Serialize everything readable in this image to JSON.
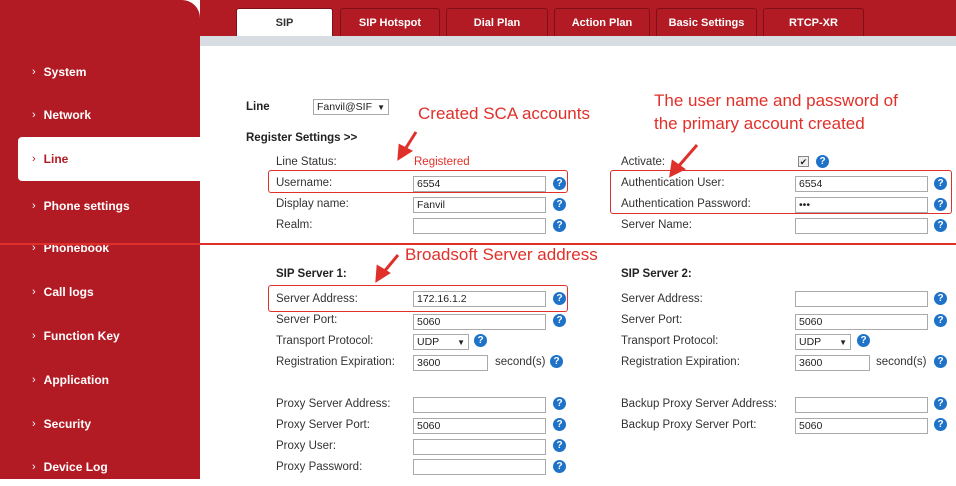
{
  "sidebar": {
    "items": [
      {
        "label": "System"
      },
      {
        "label": "Network"
      },
      {
        "label": "Line"
      },
      {
        "label": "Phone settings"
      },
      {
        "label": "Phonebook"
      },
      {
        "label": "Call logs"
      },
      {
        "label": "Function Key"
      },
      {
        "label": "Application"
      },
      {
        "label": "Security"
      },
      {
        "label": "Device Log"
      }
    ],
    "active": "Line"
  },
  "tabs": [
    {
      "label": "SIP"
    },
    {
      "label": "SIP Hotspot"
    },
    {
      "label": "Dial Plan"
    },
    {
      "label": "Action Plan"
    },
    {
      "label": "Basic Settings"
    },
    {
      "label": "RTCP-XR"
    }
  ],
  "line": {
    "label": "Line",
    "value": "Fanvil@SIF"
  },
  "register": {
    "heading": "Register Settings >>",
    "line_status_label": "Line Status:",
    "line_status_value": "Registered",
    "username_label": "Username:",
    "username_value": "6554",
    "display_name_label": "Display name:",
    "display_name_value": "Fanvil",
    "realm_label": "Realm:",
    "realm_value": "",
    "activate_label": "Activate:",
    "activate_checked": "✔",
    "auth_user_label": "Authentication User:",
    "auth_user_value": "6554",
    "auth_pass_label": "Authentication Password:",
    "auth_pass_value": "•••",
    "server_name_label": "Server Name:",
    "server_name_value": ""
  },
  "sip_server_1": {
    "heading": "SIP Server 1:",
    "address_label": "Server Address:",
    "address_value": "172.16.1.2",
    "port_label": "Server Port:",
    "port_value": "5060",
    "transport_label": "Transport Protocol:",
    "transport_value": "UDP",
    "expiration_label": "Registration Expiration:",
    "expiration_value": "3600",
    "unit": "second(s)"
  },
  "sip_server_2": {
    "heading": "SIP Server 2:",
    "address_label": "Server Address:",
    "address_value": "",
    "port_label": "Server Port:",
    "port_value": "5060",
    "transport_label": "Transport Protocol:",
    "transport_value": "UDP",
    "expiration_label": "Registration Expiration:",
    "expiration_value": "3600",
    "unit": "second(s)"
  },
  "proxy": {
    "address_label": "Proxy Server Address:",
    "address_value": "",
    "port_label": "Proxy Server Port:",
    "port_value": "5060",
    "user_label": "Proxy User:",
    "user_value": "",
    "password_label": "Proxy Password:",
    "password_value": "",
    "backup_address_label": "Backup Proxy Server Address:",
    "backup_address_value": "",
    "backup_port_label": "Backup Proxy Server Port:",
    "backup_port_value": "5060"
  },
  "annotations": {
    "sca": "Created SCA accounts",
    "primary_line1": "The user name and password of",
    "primary_line2": "the primary account created",
    "broadsoft": "Broadsoft Server address"
  },
  "help_glyph": "?",
  "colors": {
    "brand": "#b31b24",
    "annotation": "#e0302a",
    "help": "#1e73c8"
  }
}
